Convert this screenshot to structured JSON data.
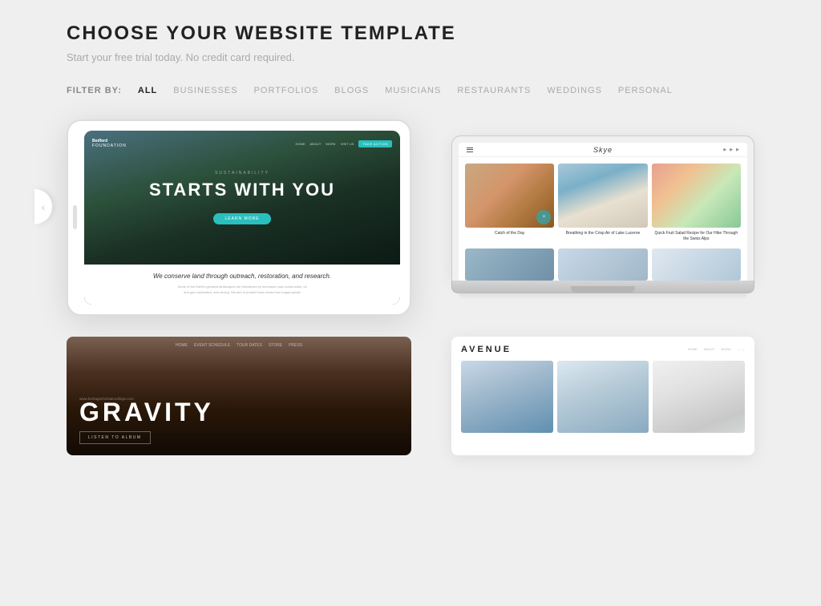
{
  "page": {
    "title": "CHOOSE YOUR WEBSITE TEMPLATE",
    "subtitle": "Start your free trial today. No credit card required."
  },
  "filter": {
    "label": "FILTER BY:",
    "items": [
      {
        "id": "all",
        "label": "ALL",
        "active": true
      },
      {
        "id": "businesses",
        "label": "BUSINESSES",
        "active": false
      },
      {
        "id": "portfolios",
        "label": "PORTFOLIOS",
        "active": false
      },
      {
        "id": "blogs",
        "label": "BLOGS",
        "active": false
      },
      {
        "id": "musicians",
        "label": "MUSICIANS",
        "active": false
      },
      {
        "id": "restaurants",
        "label": "RESTAURANTS",
        "active": false
      },
      {
        "id": "weddings",
        "label": "WEDDINGS",
        "active": false
      },
      {
        "id": "personal",
        "label": "PERSONAL",
        "active": false
      }
    ]
  },
  "templates": [
    {
      "id": "bedford",
      "name": "Bedford",
      "type": "tablet",
      "tagline": "SUSTAINABILITY",
      "hero_title": "STARTS WITH YOU",
      "cta": "LEARN MORE",
      "bottom_title": "We conserve land through outreach, restoration, and research.",
      "bottom_text": "Some of the Earth's greatest landscapes are threatened by increased road construction, oil and gas exploration, and mining. We aim to protect these areas from inappropriate"
    },
    {
      "id": "skye",
      "name": "Skye",
      "type": "laptop",
      "posts": [
        {
          "title": "Catch of the Day"
        },
        {
          "title": "Breathing in the Crisp Air of Lake Lucerne"
        },
        {
          "title": "Quick Fruit Salad Recipe for Our Hike Through the Swiss Alps"
        }
      ]
    },
    {
      "id": "gravity",
      "name": "Gravity",
      "type": "flat",
      "title": "GRAVITY",
      "url": "www.heritagechristiancollege.com",
      "cta": "LISTEN TO ALBUM"
    },
    {
      "id": "avenue",
      "name": "AVENUE",
      "type": "flat"
    }
  ],
  "icons": {
    "hamburger": "☰",
    "chevron_left": "‹"
  }
}
